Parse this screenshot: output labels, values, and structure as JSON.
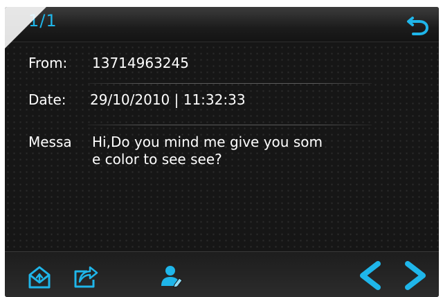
{
  "header": {
    "counter": "1/1"
  },
  "fields": {
    "from_label": "From:",
    "from_value": "13714963245",
    "date_label": "Date:",
    "date_value": "29/10/2010 | 11:32:33",
    "message_label": "Messa",
    "message_line1": "Hi,Do you mind me give you som",
    "message_line2": "e color to see see?"
  },
  "toolbar": {
    "icons": [
      "envelope-reply-icon",
      "share-forward-icon",
      "contact-icon",
      "previous-arrow-icon",
      "next-arrow-icon",
      "back-return-icon"
    ]
  },
  "colors": {
    "accent": "#1fb6ea",
    "background": "#161616",
    "text": "#ffffff"
  }
}
